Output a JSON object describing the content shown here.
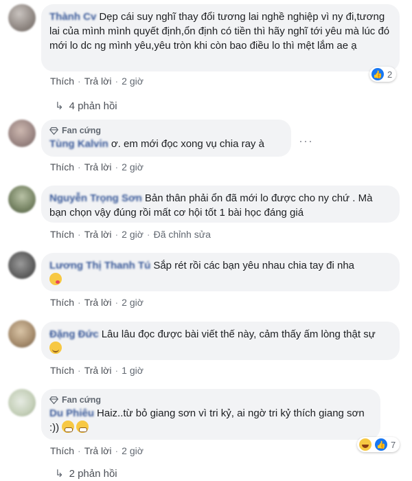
{
  "colors": {
    "link": "#385898",
    "bubble": "#f2f3f5",
    "meta": "#606770",
    "like_blue": "#1877f2"
  },
  "labels": {
    "like": "Thích",
    "reply": "Trả lời",
    "separator": "·",
    "fan_badge": "Fan cứng",
    "edited": "Đã chỉnh sửa"
  },
  "comments": [
    {
      "author": "Thành Cv",
      "text": "Dẹp cái suy nghĩ thay đổi tương lai nghề nghiệp vì ny đi,tương lai của mình mình quyết định,ổn định có tiền thì hãy nghĩ tới yêu mà lúc đó mới lo dc ng mình yêu,yêu tròn khi còn bao điều lo thì mệt lắm ae ạ",
      "time": "2 giờ",
      "reaction_count": "2",
      "reaction_icon": "like-icon",
      "replies": "4 phản hồi"
    },
    {
      "author": "Tùng Kalvin",
      "text": "ơ. em mới đọc xong vụ chia ray à",
      "time": "2 giờ"
    },
    {
      "author": "Nguyễn Trọng Sơn",
      "text": "Bản thân phải ổn đã mới lo được cho ny chứ . Mà bạn chọn vậy đúng rồi mất cơ hội tốt 1 bài học đáng giá",
      "time": "2 giờ"
    },
    {
      "author": "Lương Thị Thanh Tú",
      "text": "Sắp rét rồi các bạn yêu nhau chia tay đi nha",
      "emoji": "kissing-face-icon",
      "time": "2 giờ"
    },
    {
      "author": "Đặng Đức",
      "text": "Lâu lâu đọc được bài viết thế này, cảm thấy ấm lòng thật sự",
      "emoji": "smiling-face-icon",
      "time": "1 giờ"
    },
    {
      "author": "Du Phiêu",
      "text": "Haiz..từ bỏ giang sơn vì tri kỷ, ai ngờ tri kỷ thích giang sơn :))",
      "emoji": "grimacing-face-icon",
      "time": "2 giờ",
      "reaction_count": "7",
      "reaction_icon": "haha-icon",
      "replies": "2 phản hồi"
    }
  ]
}
